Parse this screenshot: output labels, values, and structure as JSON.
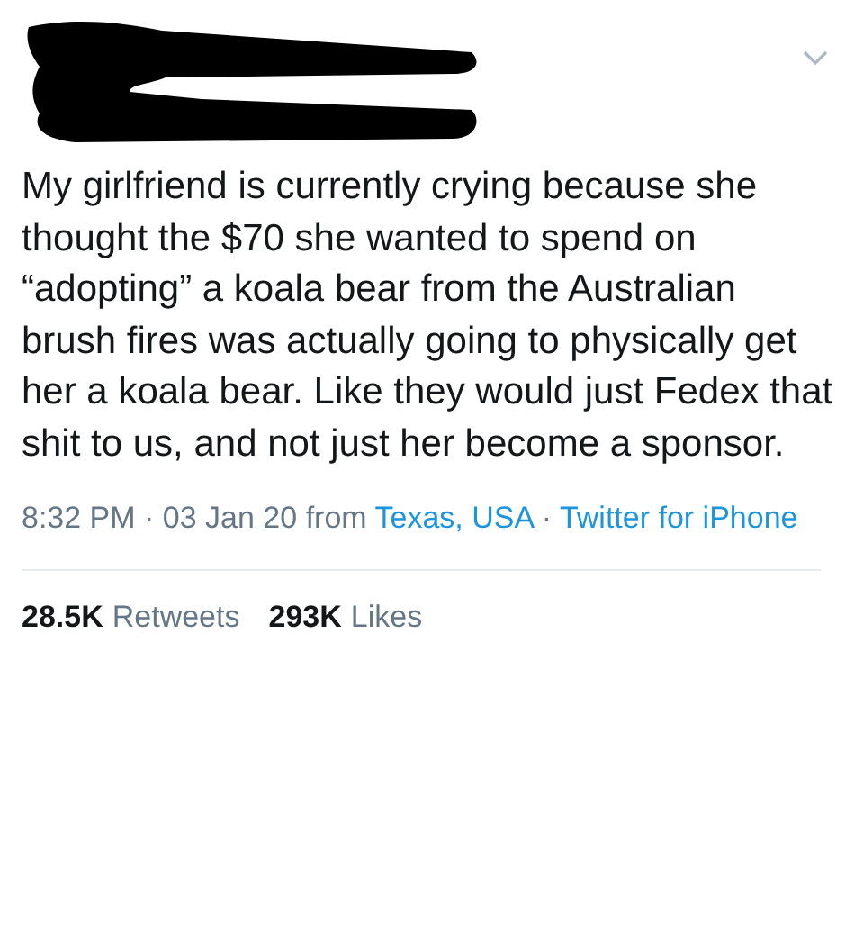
{
  "tweet": {
    "author_redacted": true,
    "text": "My girlfriend is currently crying because she thought the $70 she wanted to spend on “adopting” a koala bear from the Australian brush fires was actually going to physically get her a koala bear. Like they would just Fedex that shit to us, and not just her become a sponsor.",
    "timestamp": "8:32 PM · 03 Jan 20 from",
    "location": "Texas, USA",
    "separator": "·",
    "source": "Twitter for iPhone",
    "stats": [
      {
        "count": "28.5K",
        "label": "Retweets"
      },
      {
        "count": "293K",
        "label": "Likes"
      }
    ]
  }
}
